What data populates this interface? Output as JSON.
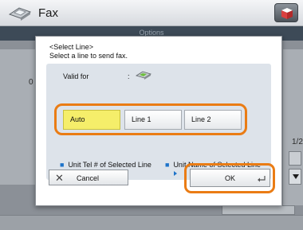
{
  "header": {
    "title": "Fax",
    "subtitle": "Options"
  },
  "background": {
    "left_fragment_top": "0",
    "right_fragment": "1/2"
  },
  "dialog": {
    "title_line1": "<Select Line>",
    "title_line2": "Select a line to send fax.",
    "valid_for_label": "Valid for",
    "valid_for_sep": ":",
    "lines": [
      {
        "label": "Auto",
        "selected": true
      },
      {
        "label": "Line 1",
        "selected": false
      },
      {
        "label": "Line 2",
        "selected": false
      }
    ],
    "info_tel": "Unit Tel # of Selected Line",
    "info_name": "Unit Name of Selected Line",
    "cancel_label": "Cancel",
    "ok_label": "OK"
  },
  "colors": {
    "highlight": "#ea7c14",
    "selected": "#f5ee6a",
    "bullet": "#1e73c9"
  }
}
